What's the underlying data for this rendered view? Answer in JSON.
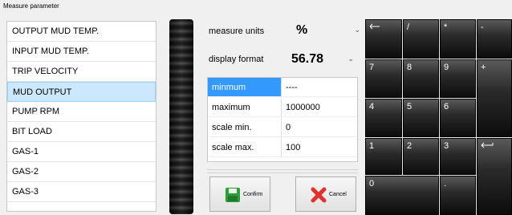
{
  "window": {
    "title": "Measure parameter"
  },
  "parameters": [
    {
      "label": "OUTPUT MUD TEMP.",
      "selected": false
    },
    {
      "label": "INPUT MUD TEMP.",
      "selected": false
    },
    {
      "label": "TRIP VELOCITY",
      "selected": false
    },
    {
      "label": "MUD OUTPUT",
      "selected": true
    },
    {
      "label": "PUMP RPM",
      "selected": false
    },
    {
      "label": "BIT LOAD",
      "selected": false
    },
    {
      "label": "GAS-1",
      "selected": false
    },
    {
      "label": "GAS-2",
      "selected": false
    },
    {
      "label": "GAS-3",
      "selected": false
    }
  ],
  "measure_units": {
    "label": "measure units",
    "value": "%"
  },
  "display_format": {
    "label": "display format",
    "value": "56.78"
  },
  "properties": [
    {
      "key": "minmum",
      "value": "----"
    },
    {
      "key": "maximum",
      "value": "1000000"
    },
    {
      "key": "scale min.",
      "value": "0"
    },
    {
      "key": "scale max.",
      "value": "100"
    }
  ],
  "actions": {
    "confirm": "Confirm",
    "cancel": "Cancel"
  },
  "keypad": {
    "backspace": "",
    "divide": "/",
    "multiply": "*",
    "minus": "-",
    "k7": "7",
    "k8": "8",
    "k9": "9",
    "plus": "+",
    "k4": "4",
    "k5": "5",
    "k6": "6",
    "k1": "1",
    "k2": "2",
    "k3": "3",
    "enter": "",
    "k0": "0",
    "dot": "."
  },
  "colors": {
    "selection": "#cce8ff",
    "grid_selection": "#3399ff",
    "key_dark": "#0c0c0c",
    "confirm_icon": "#2e9e3a",
    "cancel_icon": "#e03030"
  }
}
